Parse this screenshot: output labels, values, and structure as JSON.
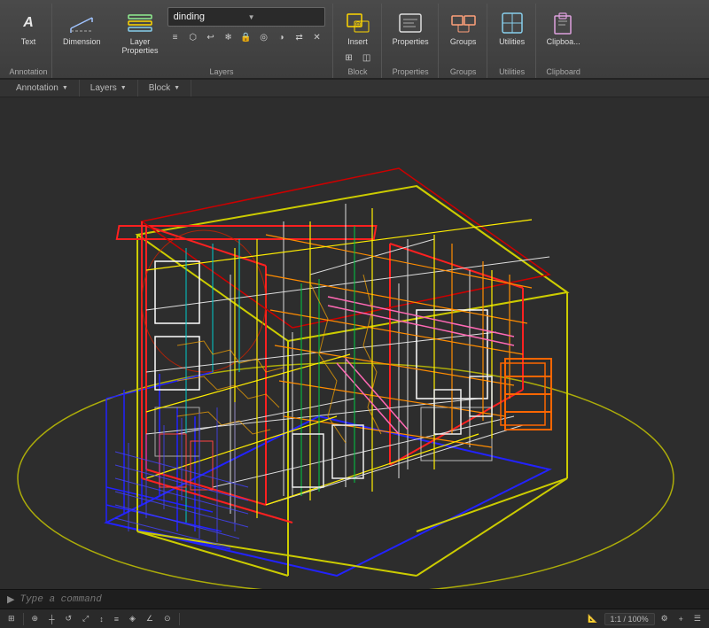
{
  "toolbar": {
    "groups": {
      "annotation": {
        "label": "Annotation",
        "text_btn_label": "Text",
        "dimension_btn_label": "Dimension"
      },
      "layers": {
        "label": "Layers",
        "layer_props_label": "Layer\nProperties",
        "current_layer": "dinding",
        "dropdown_arrow": "▼"
      },
      "block": {
        "label": "Block",
        "insert_label": "Insert"
      },
      "properties": {
        "label": "Properties",
        "props_label": "Properties"
      },
      "groups": {
        "label": "Groups",
        "groups_label": "Groups"
      },
      "utilities": {
        "label": "Utilities",
        "utilities_label": "Utilities"
      },
      "clipboard": {
        "label": "Clipboard",
        "clipboard_label": "Clipboa..."
      }
    },
    "ribbon_tabs": [
      {
        "label": "Annotation",
        "has_arrow": true
      },
      {
        "label": "Layers",
        "has_arrow": true
      },
      {
        "label": "Block",
        "has_arrow": true
      }
    ]
  },
  "viewport": {
    "background": "#2d2d2d"
  },
  "command_bar": {
    "placeholder": "Type a command",
    "prompt": "▶"
  },
  "status_bar": {
    "zoom": "1:1 / 100%",
    "items": [
      "⊞",
      "┼",
      "↺",
      "⤢",
      "↕",
      "◈",
      "∠",
      "⊙",
      "Δ",
      "⬡",
      "⬢",
      "⊞",
      "◫",
      "⟲",
      "⊕",
      "⊗",
      "⊞",
      "◈",
      "⟳",
      "⊙",
      "📐",
      "⚡",
      "🔒"
    ]
  },
  "icons": {
    "text": "A",
    "dimension": "↔",
    "layer_properties": "▤",
    "insert": "⊕",
    "properties": "☰",
    "groups": "⬡",
    "utilities": "🔧",
    "clipboard": "📋",
    "dropdown_arrow": "▼",
    "command_prompt": "▶"
  }
}
